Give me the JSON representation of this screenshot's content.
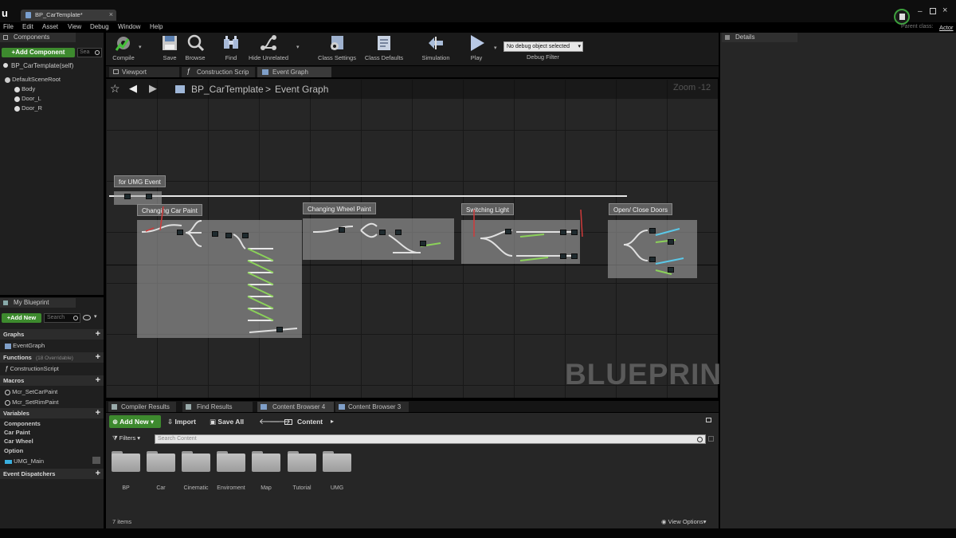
{
  "titlebar": {
    "tab_title": "BP_CarTemplate*",
    "parent_class_label": "Parent class:",
    "parent_class_value": "Actor",
    "window_controls": [
      "minimize-icon",
      "maximize-icon",
      "close-icon"
    ]
  },
  "menu": [
    "File",
    "Edit",
    "Asset",
    "View",
    "Debug",
    "Window",
    "Help"
  ],
  "toolbar": {
    "compile": "Compile",
    "save": "Save",
    "browse": "Browse",
    "find": "Find",
    "hide_unrelated": "Hide Unrelated",
    "class_settings": "Class Settings",
    "class_defaults": "Class Defaults",
    "simulation": "Simulation",
    "play": "Play",
    "debug_select": "No debug object selected",
    "debug_filter": "Debug Filter"
  },
  "components_panel": {
    "title": "Components",
    "add_component": "+Add Component",
    "search_placeholder": "Sea",
    "self": "BP_CarTemplate(self)",
    "tree": [
      {
        "label": "DefaultSceneRoot",
        "depth": 0
      },
      {
        "label": "Body",
        "depth": 1
      },
      {
        "label": "Door_L",
        "depth": 1
      },
      {
        "label": "Door_R",
        "depth": 1
      }
    ]
  },
  "my_blueprint": {
    "title": "My Blueprint",
    "add_new": "+Add New",
    "search_placeholder": "Search",
    "sections": [
      {
        "name": "Graphs",
        "note": "",
        "items": [
          "EventGraph"
        ]
      },
      {
        "name": "Functions",
        "note": "(18 Overridable)",
        "items": [
          "ConstructionScript"
        ]
      },
      {
        "name": "Macros",
        "note": "",
        "items": [
          "Mcr_SetCarPaint",
          "Mcr_SetRimPaint"
        ]
      },
      {
        "name": "Variables",
        "note": "",
        "items": []
      }
    ],
    "variable_groups": [
      "Components",
      "Car Paint",
      "Car Wheel",
      "Option"
    ],
    "variable_item": "UMG_Main",
    "event_dispatchers": "Event Dispatchers"
  },
  "graph_tabs": [
    "Viewport",
    "Construction Scrip",
    "Event Graph"
  ],
  "graph": {
    "breadcrumb_root": "BP_CarTemplate",
    "breadcrumb_leaf": "Event Graph",
    "zoom": "Zoom -12",
    "watermark": "BLUEPRINT",
    "comments": [
      "for UMG Event",
      "Changing Car Paint",
      "Changing Wheel Paint",
      "Switching Light",
      "Open/ Close Doors"
    ]
  },
  "details_panel": {
    "title": "Details"
  },
  "bottom_tabs": [
    "Compiler Results",
    "Find Results",
    "Content Browser 4",
    "Content Browser 3"
  ],
  "content_browser": {
    "add_new": "Add New",
    "import": "Import",
    "save_all": "Save All",
    "path": "Content",
    "filters": "Filters",
    "search_placeholder": "Search Content",
    "folders": [
      "BP",
      "Car",
      "Cinematic",
      "Enviroment",
      "Map",
      "Tutorial",
      "UMG"
    ],
    "item_count": "7 items",
    "view_options": "View Options"
  }
}
